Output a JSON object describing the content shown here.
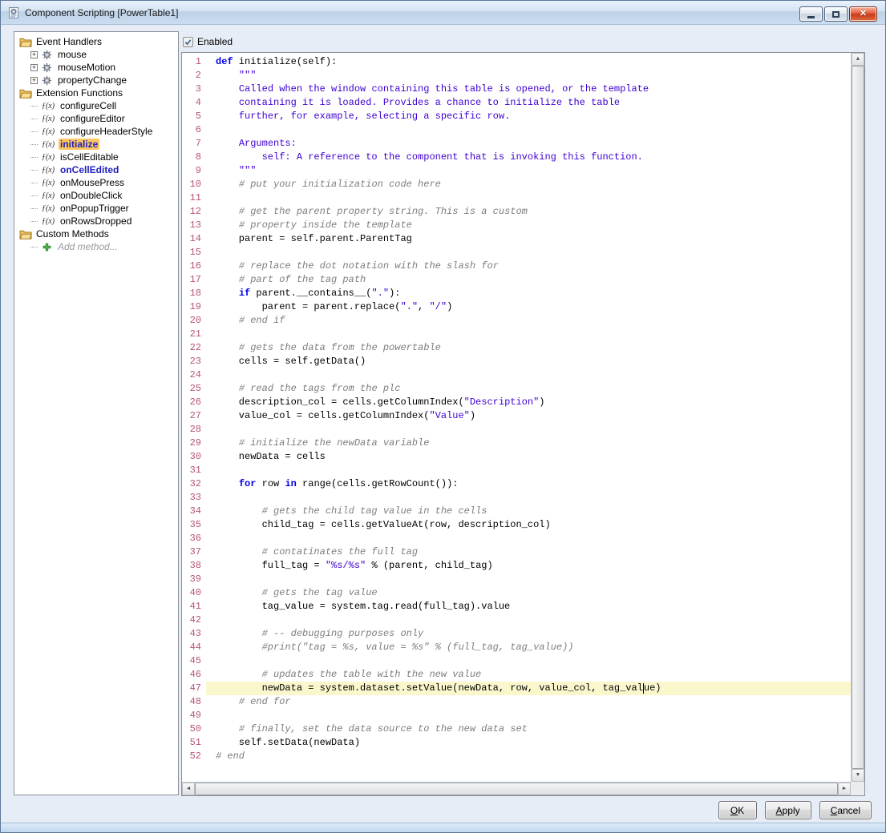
{
  "window": {
    "title": "Component Scripting [PowerTable1]"
  },
  "sidebar": {
    "items": [
      {
        "label": "Event Handlers",
        "icon": "folder",
        "depth": 0
      },
      {
        "label": "mouse",
        "icon": "event",
        "depth": 1,
        "expander": true
      },
      {
        "label": "mouseMotion",
        "icon": "event",
        "depth": 1,
        "expander": true
      },
      {
        "label": "propertyChange",
        "icon": "event",
        "depth": 1,
        "expander": true
      },
      {
        "label": "Extension Functions",
        "icon": "folder",
        "depth": 0
      },
      {
        "label": "configureCell",
        "icon": "fx",
        "depth": 1
      },
      {
        "label": "configureEditor",
        "icon": "fx",
        "depth": 1
      },
      {
        "label": "configureHeaderStyle",
        "icon": "fx",
        "depth": 1
      },
      {
        "label": "initialize",
        "icon": "fx",
        "depth": 1,
        "selected": true,
        "emphasis": "bold-blue"
      },
      {
        "label": "isCellEditable",
        "icon": "fx",
        "depth": 1
      },
      {
        "label": "onCellEdited",
        "icon": "fx",
        "depth": 1,
        "emphasis": "bold-blue"
      },
      {
        "label": "onMousePress",
        "icon": "fx",
        "depth": 1
      },
      {
        "label": "onDoubleClick",
        "icon": "fx",
        "depth": 1
      },
      {
        "label": "onPopupTrigger",
        "icon": "fx",
        "depth": 1
      },
      {
        "label": "onRowsDropped",
        "icon": "fx",
        "depth": 1
      },
      {
        "label": "Custom Methods",
        "icon": "folder",
        "depth": 0
      },
      {
        "label": "Add method...",
        "icon": "plus",
        "depth": 1,
        "emphasis": "ghost"
      }
    ]
  },
  "editor": {
    "enabled_label": "Enabled",
    "line_count": 52,
    "current_line": 47,
    "scrollbar": {
      "up": "▲",
      "down": "▼",
      "left": "◀",
      "right": "▶"
    },
    "colors": {
      "keyword": "#0000e6",
      "string": "#3f00d0",
      "comment": "#7d7d7d",
      "line_number": "#b5547a",
      "current_line_bg": "#fbf7cd",
      "tree_selection_bg": "#fdc660"
    },
    "lines": [
      [
        [
          "k",
          "def"
        ],
        [
          "p",
          " initialize(self):"
        ]
      ],
      [
        [
          "p",
          "    "
        ],
        [
          "s",
          "\"\"\""
        ]
      ],
      [
        [
          "p",
          "    "
        ],
        [
          "s",
          "Called when the window containing this table is opened, or the template"
        ]
      ],
      [
        [
          "p",
          "    "
        ],
        [
          "s",
          "containing it is loaded. Provides a chance to initialize the table"
        ]
      ],
      [
        [
          "p",
          "    "
        ],
        [
          "s",
          "further, for example, selecting a specific row."
        ]
      ],
      [],
      [
        [
          "p",
          "    "
        ],
        [
          "s",
          "Arguments:"
        ]
      ],
      [
        [
          "p",
          "        "
        ],
        [
          "s",
          "self: A reference to the component that is invoking this function."
        ]
      ],
      [
        [
          "p",
          "    "
        ],
        [
          "s",
          "\"\"\""
        ]
      ],
      [
        [
          "p",
          "    "
        ],
        [
          "c",
          "# put your initialization code here"
        ]
      ],
      [],
      [
        [
          "p",
          "    "
        ],
        [
          "c",
          "# get the parent property string. This is a custom"
        ]
      ],
      [
        [
          "p",
          "    "
        ],
        [
          "c",
          "# property inside the template"
        ]
      ],
      [
        [
          "p",
          "    parent = self.parent.ParentTag"
        ]
      ],
      [],
      [
        [
          "p",
          "    "
        ],
        [
          "c",
          "# replace the dot notation with the slash for"
        ]
      ],
      [
        [
          "p",
          "    "
        ],
        [
          "c",
          "# part of the tag path"
        ]
      ],
      [
        [
          "p",
          "    "
        ],
        [
          "k",
          "if"
        ],
        [
          "p",
          " parent.__contains__("
        ],
        [
          "s",
          "\".\""
        ],
        [
          "p",
          "):"
        ]
      ],
      [
        [
          "p",
          "        parent = parent.replace("
        ],
        [
          "s",
          "\".\""
        ],
        [
          "p",
          ", "
        ],
        [
          "s",
          "\"/\""
        ],
        [
          "p",
          ")"
        ]
      ],
      [
        [
          "p",
          "    "
        ],
        [
          "c",
          "# end if"
        ]
      ],
      [],
      [
        [
          "p",
          "    "
        ],
        [
          "c",
          "# gets the data from the powertable"
        ]
      ],
      [
        [
          "p",
          "    cells = self.getData()"
        ]
      ],
      [],
      [
        [
          "p",
          "    "
        ],
        [
          "c",
          "# read the tags from the plc"
        ]
      ],
      [
        [
          "p",
          "    description_col = cells.getColumnIndex("
        ],
        [
          "s",
          "\"Description\""
        ],
        [
          "p",
          ")"
        ]
      ],
      [
        [
          "p",
          "    value_col = cells.getColumnIndex("
        ],
        [
          "s",
          "\"Value\""
        ],
        [
          "p",
          ")"
        ]
      ],
      [],
      [
        [
          "p",
          "    "
        ],
        [
          "c",
          "# initialize the newData variable"
        ]
      ],
      [
        [
          "p",
          "    newData = cells"
        ]
      ],
      [],
      [
        [
          "p",
          "    "
        ],
        [
          "k",
          "for"
        ],
        [
          "p",
          " row "
        ],
        [
          "k",
          "in"
        ],
        [
          "p",
          " range(cells.getRowCount()):"
        ]
      ],
      [],
      [
        [
          "p",
          "        "
        ],
        [
          "c",
          "# gets the child tag value in the cells"
        ]
      ],
      [
        [
          "p",
          "        child_tag = cells.getValueAt(row, description_col)"
        ]
      ],
      [],
      [
        [
          "p",
          "        "
        ],
        [
          "c",
          "# contatinates the full tag"
        ]
      ],
      [
        [
          "p",
          "        full_tag = "
        ],
        [
          "s",
          "\"%s/%s\""
        ],
        [
          "p",
          " % (parent, child_tag)"
        ]
      ],
      [],
      [
        [
          "p",
          "        "
        ],
        [
          "c",
          "# gets the tag value"
        ]
      ],
      [
        [
          "p",
          "        tag_value = system.tag.read(full_tag).value"
        ]
      ],
      [],
      [
        [
          "p",
          "        "
        ],
        [
          "c",
          "# -- debugging purposes only"
        ]
      ],
      [
        [
          "p",
          "        "
        ],
        [
          "c",
          "#print(\"tag = %s, value = %s\" % (full_tag, tag_value))"
        ]
      ],
      [],
      [
        [
          "p",
          "        "
        ],
        [
          "c",
          "# updates the table with the new value"
        ]
      ],
      [
        [
          "p",
          "        newData = system.dataset.setValue(newData, row, value_col, tag_val"
        ],
        [
          "caret",
          ""
        ],
        [
          "p",
          "ue)"
        ]
      ],
      [
        [
          "p",
          "    "
        ],
        [
          "c",
          "# end for"
        ]
      ],
      [],
      [
        [
          "p",
          "    "
        ],
        [
          "c",
          "# finally, set the data source to the new data set"
        ]
      ],
      [
        [
          "p",
          "    self.setData(newData)"
        ]
      ],
      [
        [
          "c",
          "# end"
        ]
      ]
    ]
  },
  "footer": {
    "buttons": [
      {
        "label": "OK"
      },
      {
        "label": "Apply"
      },
      {
        "label": "Cancel"
      }
    ]
  }
}
